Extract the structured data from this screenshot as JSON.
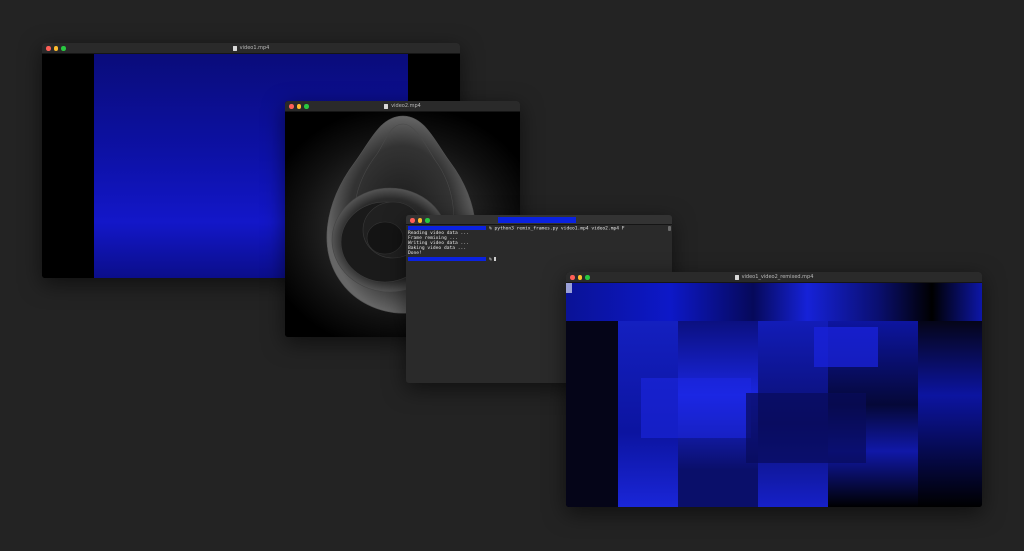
{
  "windows": {
    "video1": {
      "title": "video1.mp4"
    },
    "video2": {
      "title": "video2.mp4"
    },
    "terminal": {
      "command": "% python3 remix_frames.py video1.mp4 video2.mp4 F",
      "lines": [
        "Reading video data ...",
        "Frame remixing ...",
        "Writing video data ...",
        "Baking video data ...",
        "Done!"
      ],
      "prompt_end": "%"
    },
    "result": {
      "title": "video1_video2_remixed.mp4"
    }
  },
  "colors": {
    "desktop": "#232323",
    "accent_blue": "#0b22e0",
    "traffic_red": "#ff5f57",
    "traffic_yellow": "#febc2e",
    "traffic_green": "#28c840"
  },
  "icons": [
    "file-icon",
    "close-icon",
    "minimize-icon",
    "zoom-icon"
  ]
}
